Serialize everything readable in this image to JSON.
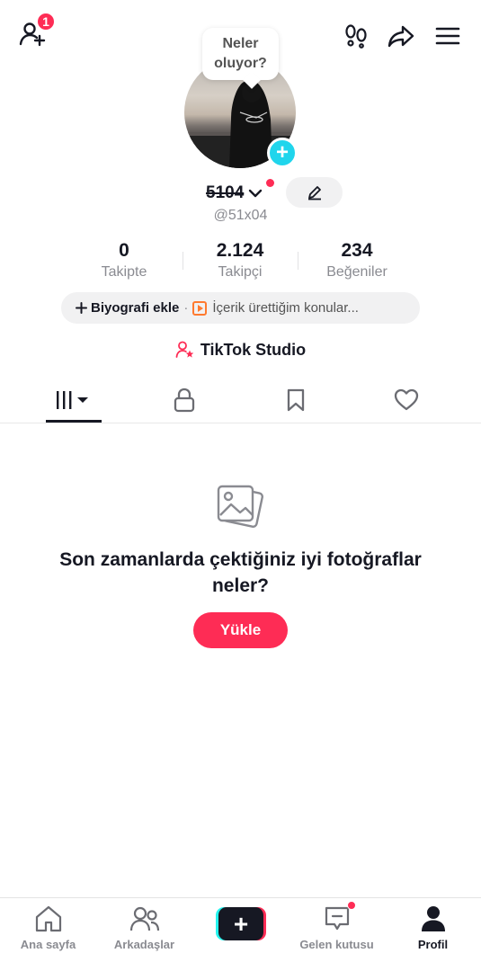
{
  "top_bar": {
    "notification_count": "1"
  },
  "profile": {
    "bubble_text": "Neler oluyor?",
    "display_name": "5104",
    "username": "@51x04"
  },
  "stats": [
    {
      "value": "0",
      "label": "Takipte"
    },
    {
      "value": "2.124",
      "label": "Takipçi"
    },
    {
      "value": "234",
      "label": "Beğeniler"
    }
  ],
  "bio": {
    "add_label": "Biyografi ekle",
    "separator": "·",
    "topic_label": "İçerik ürettiğim konular..."
  },
  "studio": {
    "label": "TikTok Studio"
  },
  "empty_state": {
    "title": "Son zamanlarda çektiğiniz iyi fotoğraflar neler?",
    "upload_label": "Yükle"
  },
  "bottom_nav": {
    "home": "Ana sayfa",
    "friends": "Arkadaşlar",
    "create": "+",
    "inbox": "Gelen kutusu",
    "profile": "Profil"
  },
  "colors": {
    "accent": "#fe2c55",
    "cyan": "#25f4ee",
    "text": "#161823",
    "muted": "#8a8b91"
  }
}
